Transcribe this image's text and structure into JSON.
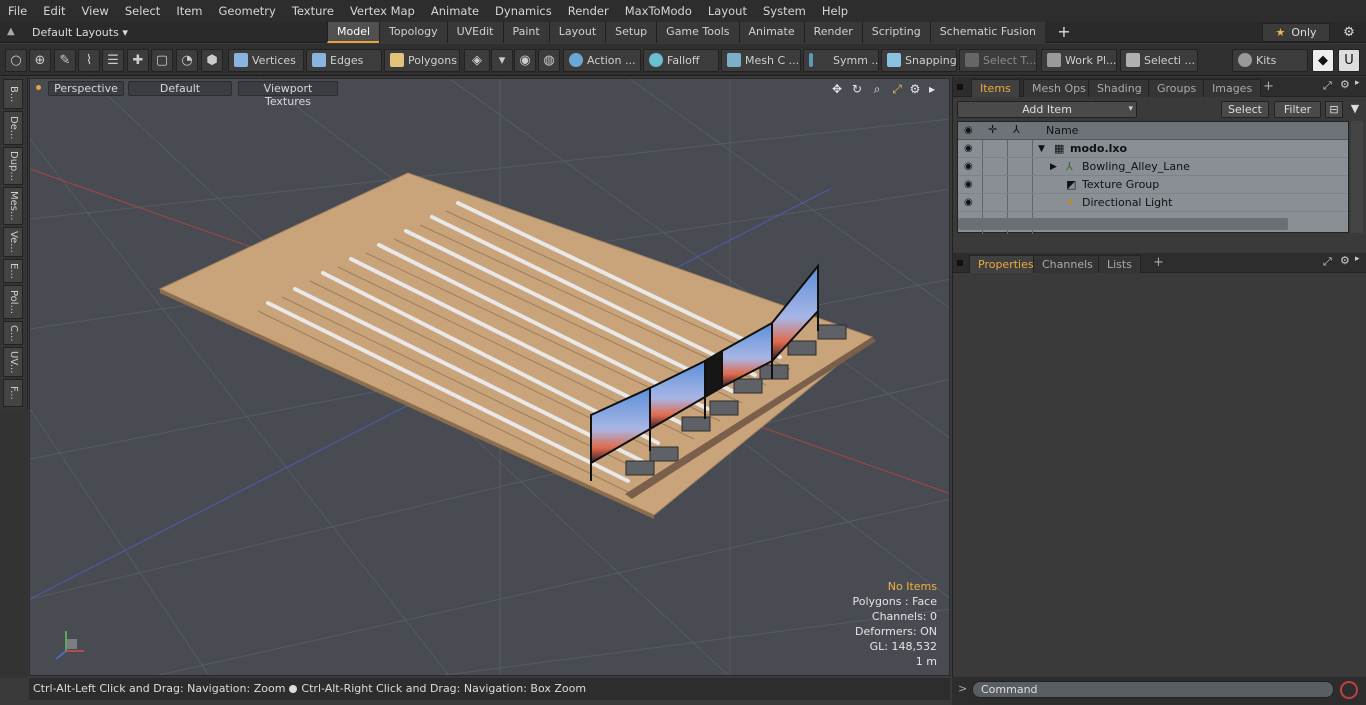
{
  "menu": [
    "File",
    "Edit",
    "View",
    "Select",
    "Item",
    "Geometry",
    "Texture",
    "Vertex Map",
    "Animate",
    "Dynamics",
    "Render",
    "MaxToModo",
    "Layout",
    "System",
    "Help"
  ],
  "layout_dropdown": "Default Layouts",
  "mode_tabs": [
    "Model",
    "Topology",
    "UVEdit",
    "Paint",
    "Layout",
    "Setup",
    "Game Tools",
    "Animate",
    "Render",
    "Scripting",
    "Schematic Fusion"
  ],
  "active_mode_tab": "Model",
  "only_label": "Only",
  "toolbar": {
    "vertices": "Vertices",
    "edges": "Edges",
    "polygons": "Polygons",
    "action": "Action ...",
    "falloff": "Falloff",
    "mesh": "Mesh C ...",
    "symmetry": "Symm ...",
    "snapping": "Snapping",
    "select_t": "Select T...",
    "work_plane": "Work Pl...",
    "selection": "Selecti ...",
    "kits": "Kits"
  },
  "left_tabs": [
    "B...",
    "De...",
    "Dup...",
    "Mes...",
    "Ve...",
    "E...",
    "Pol...",
    "C...",
    "UV...",
    "F..."
  ],
  "viewport": {
    "perspective": "Perspective",
    "shading": "Default",
    "textures": "Viewport Textures",
    "info": {
      "no_items": "No Items",
      "polygons": "Polygons : Face",
      "channels": "Channels: 0",
      "deformers": "Deformers: ON",
      "gl": "GL: 148,532",
      "scale": "1 m"
    }
  },
  "status": {
    "hint1": "Ctrl-Alt-Left Click and Drag: Navigation: Zoom",
    "hint2": "Ctrl-Alt-Right Click and Drag: Navigation: Box Zoom"
  },
  "items_panel": {
    "tabs": [
      "Items",
      "Mesh Ops",
      "Shading",
      "Groups",
      "Images"
    ],
    "active_tab": "Items",
    "add_item": "Add Item",
    "select": "Select",
    "filter": "Filter",
    "name_header": "Name",
    "rows": [
      {
        "label": "modo.lxo",
        "bold": true,
        "indent": 0
      },
      {
        "label": "Bowling_Alley_Lane",
        "bold": false,
        "indent": 1
      },
      {
        "label": "Texture Group",
        "bold": false,
        "indent": 1
      },
      {
        "label": "Directional Light",
        "bold": false,
        "indent": 1
      }
    ]
  },
  "props_panel": {
    "tabs": [
      "Properties",
      "Channels",
      "Lists"
    ],
    "active_tab": "Properties"
  },
  "command": {
    "placeholder": "Command"
  },
  "colors": {
    "accent": "#e8a33a",
    "viewport_bg": "#484c52",
    "floor": "#c9a37a"
  }
}
